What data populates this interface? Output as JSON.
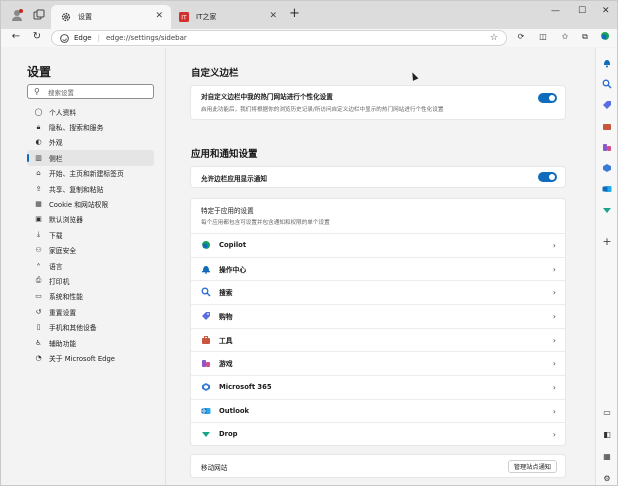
{
  "browser": {
    "tabs": [
      {
        "title": "设置",
        "active": true
      },
      {
        "title": "IT之家",
        "active": false
      }
    ],
    "address": {
      "brand": "Edge",
      "url": "edge://settings/sidebar"
    }
  },
  "sidebar_nav": {
    "title": "设置",
    "search_placeholder": "搜索设置",
    "items": [
      {
        "label": "个人资料",
        "icon": "person-icon"
      },
      {
        "label": "隐私、搜索和服务",
        "icon": "lock-icon"
      },
      {
        "label": "外观",
        "icon": "palette-icon"
      },
      {
        "label": "侧栏",
        "icon": "sidebar-icon",
        "selected": true
      },
      {
        "label": "开始、主页和新建标签页",
        "icon": "home-icon"
      },
      {
        "label": "共享、复制和粘贴",
        "icon": "share-icon"
      },
      {
        "label": "Cookie 和网站权限",
        "icon": "cookie-icon"
      },
      {
        "label": "默认浏览器",
        "icon": "browser-icon"
      },
      {
        "label": "下载",
        "icon": "download-icon"
      },
      {
        "label": "家庭安全",
        "icon": "family-icon"
      },
      {
        "label": "语言",
        "icon": "language-icon"
      },
      {
        "label": "打印机",
        "icon": "printer-icon"
      },
      {
        "label": "系统和性能",
        "icon": "system-icon"
      },
      {
        "label": "重置设置",
        "icon": "reset-icon"
      },
      {
        "label": "手机和其他设备",
        "icon": "phone-icon"
      },
      {
        "label": "辅助功能",
        "icon": "accessibility-icon"
      },
      {
        "label": "关于 Microsoft Edge",
        "icon": "edge-icon"
      }
    ]
  },
  "customize": {
    "heading": "自定义边栏",
    "option_title": "对自定义边栏中我的热门网站进行个性化设置",
    "option_desc": "启用此功能后，我们将根据你的浏览历史记录/所访问自定义边栏中显示的热门网站进行个性化设置",
    "enabled": true
  },
  "apps": {
    "heading": "应用和通知设置",
    "notify_label": "允许边栏应用显示通知",
    "notify_enabled": true,
    "specific_title": "特定于应用的设置",
    "specific_desc": "每个应用都包含可设置并包含通知和权限的单个设置",
    "list": [
      {
        "name": "Copilot",
        "icon": "copilot-icon"
      },
      {
        "name": "操作中心",
        "icon": "action-center-icon"
      },
      {
        "name": "搜索",
        "icon": "search-icon"
      },
      {
        "name": "购物",
        "icon": "shopping-tag-icon"
      },
      {
        "name": "工具",
        "icon": "toolbox-icon"
      },
      {
        "name": "游戏",
        "icon": "games-icon"
      },
      {
        "name": "Microsoft 365",
        "icon": "m365-icon"
      },
      {
        "name": "Outlook",
        "icon": "outlook-icon"
      },
      {
        "name": "Drop",
        "icon": "drop-icon"
      }
    ],
    "mobile_label": "移动网站",
    "mobile_button": "管理站点通知"
  },
  "colors": {
    "accent": "#0f6cbd"
  }
}
